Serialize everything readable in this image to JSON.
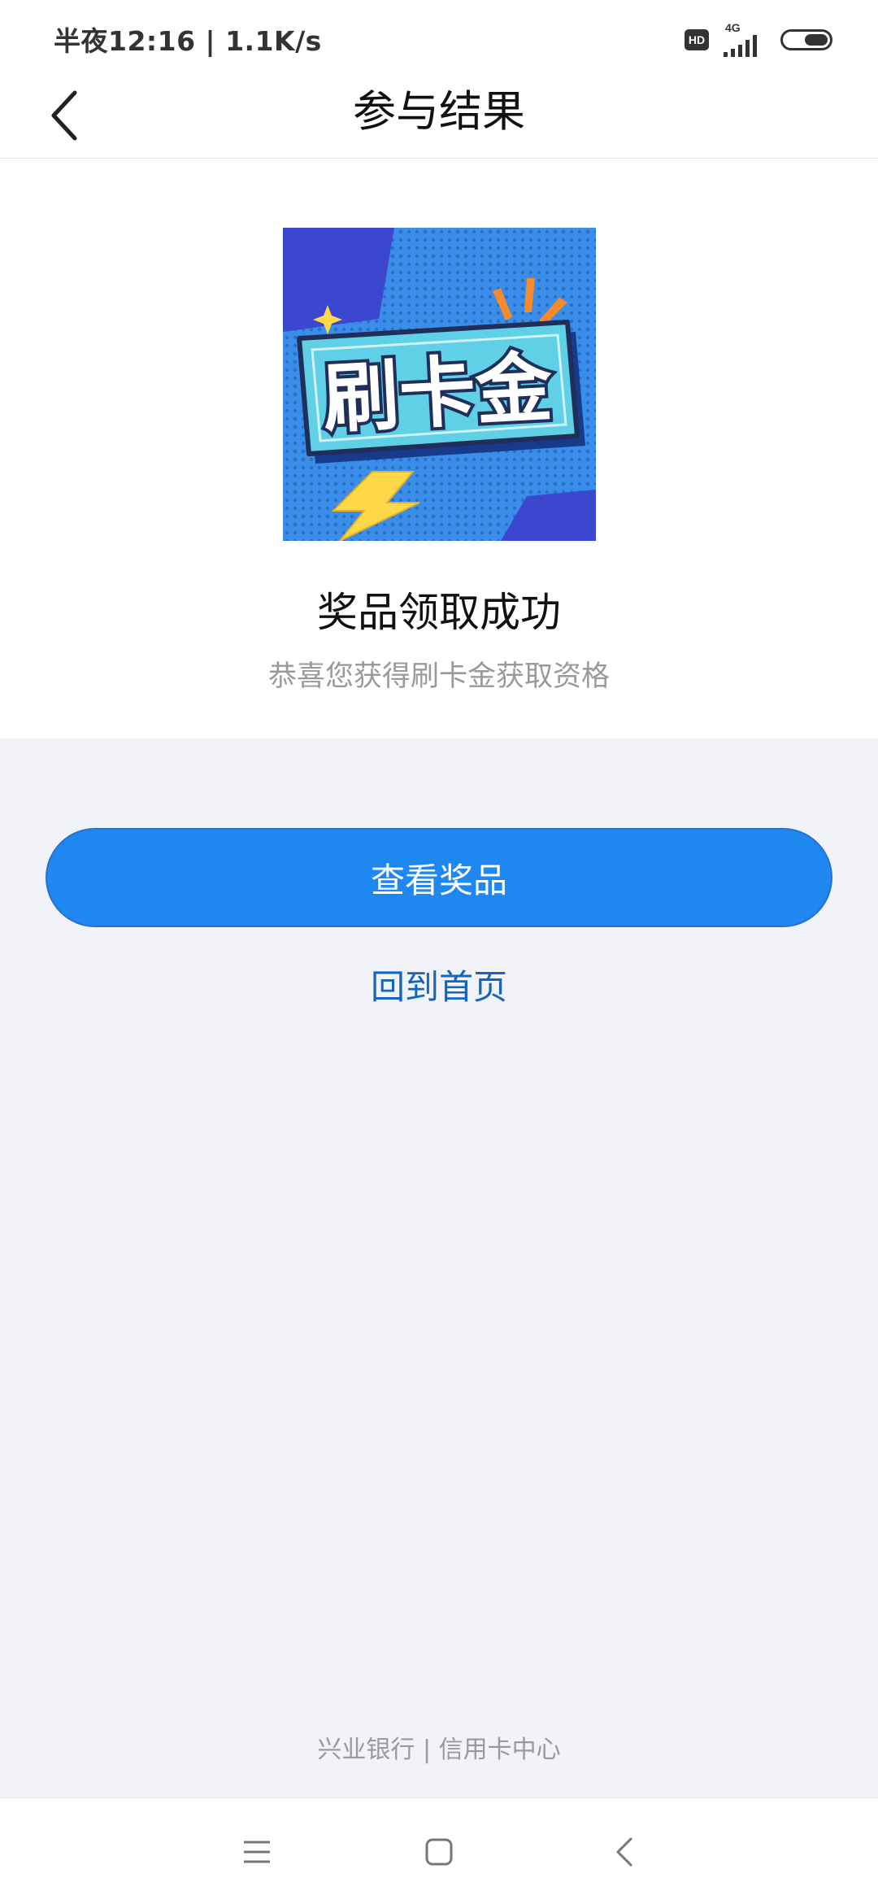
{
  "status_bar": {
    "time_speed": "半夜12:16 | 1.1K/s",
    "hd_badge": "HD",
    "network": "4G"
  },
  "header": {
    "title": "参与结果",
    "back_icon": "chevron-left-icon"
  },
  "result": {
    "image_text": "刷卡金",
    "title": "奖品领取成功",
    "subtitle": "恭喜您获得刷卡金获取资格"
  },
  "actions": {
    "view_prize_label": "查看奖品",
    "back_home_label": "回到首页"
  },
  "footer": {
    "text": "兴业银行 | 信用卡中心"
  },
  "system_nav": {
    "menu_icon": "menu-icon",
    "home_icon": "home-square-icon",
    "back_icon": "back-triangle-icon"
  },
  "colors": {
    "primary_button": "#1e87f0",
    "link": "#1565c0",
    "page_background": "#f1f3f8",
    "image_background": "#3a8de8",
    "image_banner": "#5fd0e6"
  }
}
